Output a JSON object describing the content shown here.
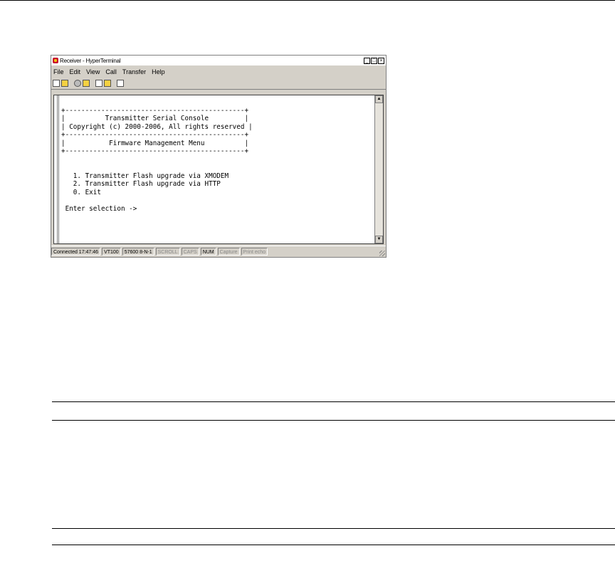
{
  "window": {
    "title": "Receiver - HyperTerminal",
    "controls": [
      "_",
      "□",
      "×"
    ]
  },
  "menu": [
    "File",
    "Edit",
    "View",
    "Call",
    "Transfer",
    "Help"
  ],
  "toolbar_icons": [
    "new-icon",
    "open-icon",
    "disconnect-icon",
    "call-icon",
    "send-icon",
    "receive-icon",
    "properties-icon"
  ],
  "terminal": {
    "lines": [
      "+---------------------------------------------+",
      "|          Transmitter Serial Console         |",
      "| Copyright (c) 2000-2006, All rights reserved |",
      "+---------------------------------------------+",
      "|           Firmware Management Menu          |",
      "+---------------------------------------------+",
      "",
      "",
      "   1. Transmitter Flash upgrade via XMODEM",
      "   2. Transmitter Flash upgrade via HTTP",
      "   0. Exit",
      "",
      " Enter selection ->"
    ]
  },
  "status": {
    "connected": "Connected 17:47:46",
    "emulation": "VT100",
    "settings": "57600 8-N-1",
    "scroll": "SCROLL",
    "caps": "CAPS",
    "num": "NUM",
    "capture": "Capture",
    "print_echo": "Print echo"
  }
}
